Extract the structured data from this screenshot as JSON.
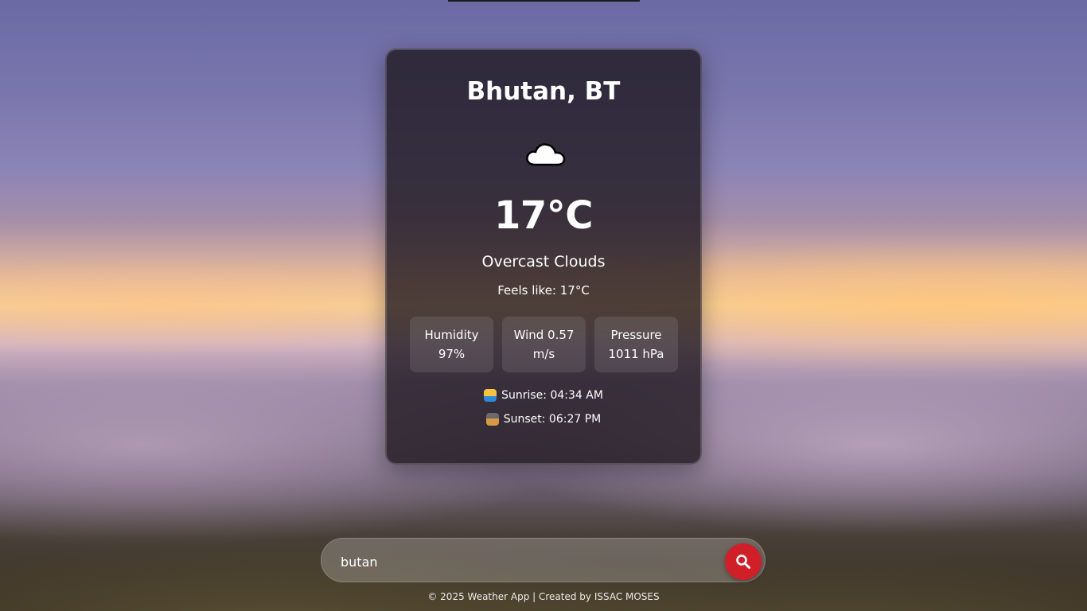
{
  "weather": {
    "location": "Bhutan, BT",
    "icon": "cloud-icon",
    "temperature": "17°C",
    "description": "Overcast Clouds",
    "feels_like": "Feels like: 17°C",
    "humidity": {
      "label": "Humidity",
      "value": "97%"
    },
    "wind": {
      "label": "Wind 0.57",
      "value": "m/s"
    },
    "pressure": {
      "label": "Pressure",
      "value": "1011 hPa"
    },
    "sunrise": "Sunrise: 04:34 AM",
    "sunset": "Sunset: 06:27 PM"
  },
  "search": {
    "value": "butan",
    "button_icon": "search-icon",
    "button_color": "#d11f2a"
  },
  "footer": {
    "text": "© 2025 Weather App | Created by ISSAC MOSES"
  }
}
